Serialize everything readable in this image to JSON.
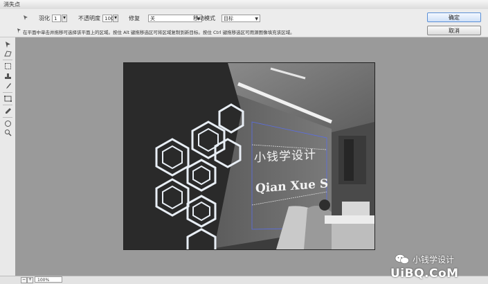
{
  "window": {
    "title": "消失点"
  },
  "options": {
    "feather_label": "羽化",
    "feather_value": "1",
    "opacity_label": "不透明度",
    "opacity_value": "100",
    "heal_label": "修复",
    "heal_value": "关",
    "move_mode_label": "移动模式",
    "move_mode_value": "目标",
    "hint": "在平面中单击并拖移可选择该平面上的区域。按住 Alt 键拖移选区可将区域复制到新目标。按住 Ctrl 键拖移选区可用源图像填充该区域。"
  },
  "buttons": {
    "ok": "确定",
    "cancel": "取消"
  },
  "toolbar": {
    "tools": [
      "edit-plane-tool-icon",
      "create-plane-tool-icon",
      "marquee-tool-icon",
      "stamp-tool-icon",
      "brush-tool-icon",
      "transform-tool-icon",
      "eyedropper-tool-icon",
      "measure-tool-icon",
      "hand-tool-icon",
      "zoom-tool-icon"
    ]
  },
  "canvas": {
    "sign_line1": "小钱学设计",
    "sign_line2": "Qian Xue S"
  },
  "status": {
    "zoom": "100%"
  },
  "watermark": {
    "line1": "小钱学设计",
    "line2": "UiBQ.CoM"
  }
}
